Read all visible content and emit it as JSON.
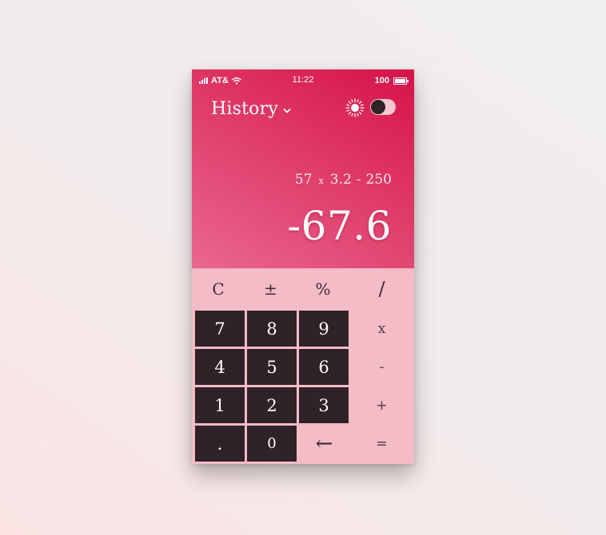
{
  "status_bar": {
    "carrier": "AT&",
    "time": "11:22",
    "battery": "100"
  },
  "header": {
    "history_label": "History",
    "theme_icon": "sun-icon",
    "theme_toggle_on": false
  },
  "display": {
    "expression": {
      "a": "57",
      "op1": "x",
      "b": "3.2",
      "op2": "-",
      "c": "250"
    },
    "result": "-67.6"
  },
  "keypad": {
    "function_row": [
      "C",
      "±",
      "%",
      "/"
    ],
    "digits": {
      "seven": "7",
      "eight": "8",
      "nine": "9",
      "four": "4",
      "five": "5",
      "six": "6",
      "one": "1",
      "two": "2",
      "three": "3",
      "dot": ".",
      "zero": "0"
    },
    "operators": {
      "multiply": "x",
      "subtract": "-",
      "add": "+",
      "equals": "="
    },
    "backspace": "←"
  },
  "colors": {
    "accent_top": "#d6124a",
    "accent_bottom": "#e96790",
    "keypad_bg": "#f4bcc6",
    "key_dark": "#2f2228"
  }
}
